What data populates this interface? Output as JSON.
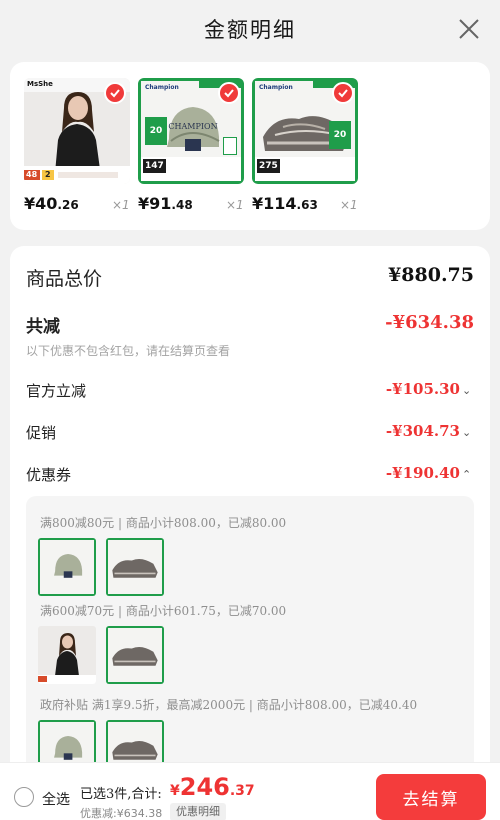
{
  "header": {
    "title": "金额明细"
  },
  "products": [
    {
      "price_int": "¥40",
      "price_dec": ".26",
      "qty": "×1"
    },
    {
      "price_int": "¥91",
      "price_dec": ".48",
      "qty": "×1"
    },
    {
      "price_int": "¥114",
      "price_dec": ".63",
      "qty": "×1"
    }
  ],
  "product_thumbs": {
    "brand1": "MsShe",
    "brand2": "Champion",
    "badge1a": "48",
    "badge1b": "2",
    "badge2": "147",
    "badge3": "275",
    "badge_num2": "20",
    "badge_num3": "20"
  },
  "summary": {
    "total_label": "商品总价",
    "total_value": "¥880.75",
    "reduce_label": "共减",
    "reduce_value": "-¥634.38",
    "reduce_note": "以下优惠不包含红包，请在结算页查看",
    "lines": [
      {
        "label": "官方立减",
        "value": "-¥105.30",
        "chev": "⌄"
      },
      {
        "label": "促销",
        "value": "-¥304.73",
        "chev": "⌄"
      },
      {
        "label": "优惠券",
        "value": "-¥190.40",
        "chev": "⌃"
      }
    ]
  },
  "coupons": [
    {
      "title": "满800减80元 | 商品小计808.00，已减80.00"
    },
    {
      "title": "满600减70元 | 商品小计601.75，已减70.00"
    },
    {
      "title": "政府补贴 满1享9.5折，最高减2000元 | 商品小计808.00，已减40.40"
    }
  ],
  "bottom": {
    "select_all": "全选",
    "selected_text": "已选3件,合计:",
    "amount_symbol": "¥",
    "amount_int": "246",
    "amount_dec": ".37",
    "reduced_note": "优惠减:¥634.38",
    "detail_tag": "优惠明细",
    "checkout": "去结算"
  },
  "colors": {
    "accent": "#ee3333",
    "checkout_bg": "#f43c3c",
    "brand_green": "#1f9d4a"
  }
}
